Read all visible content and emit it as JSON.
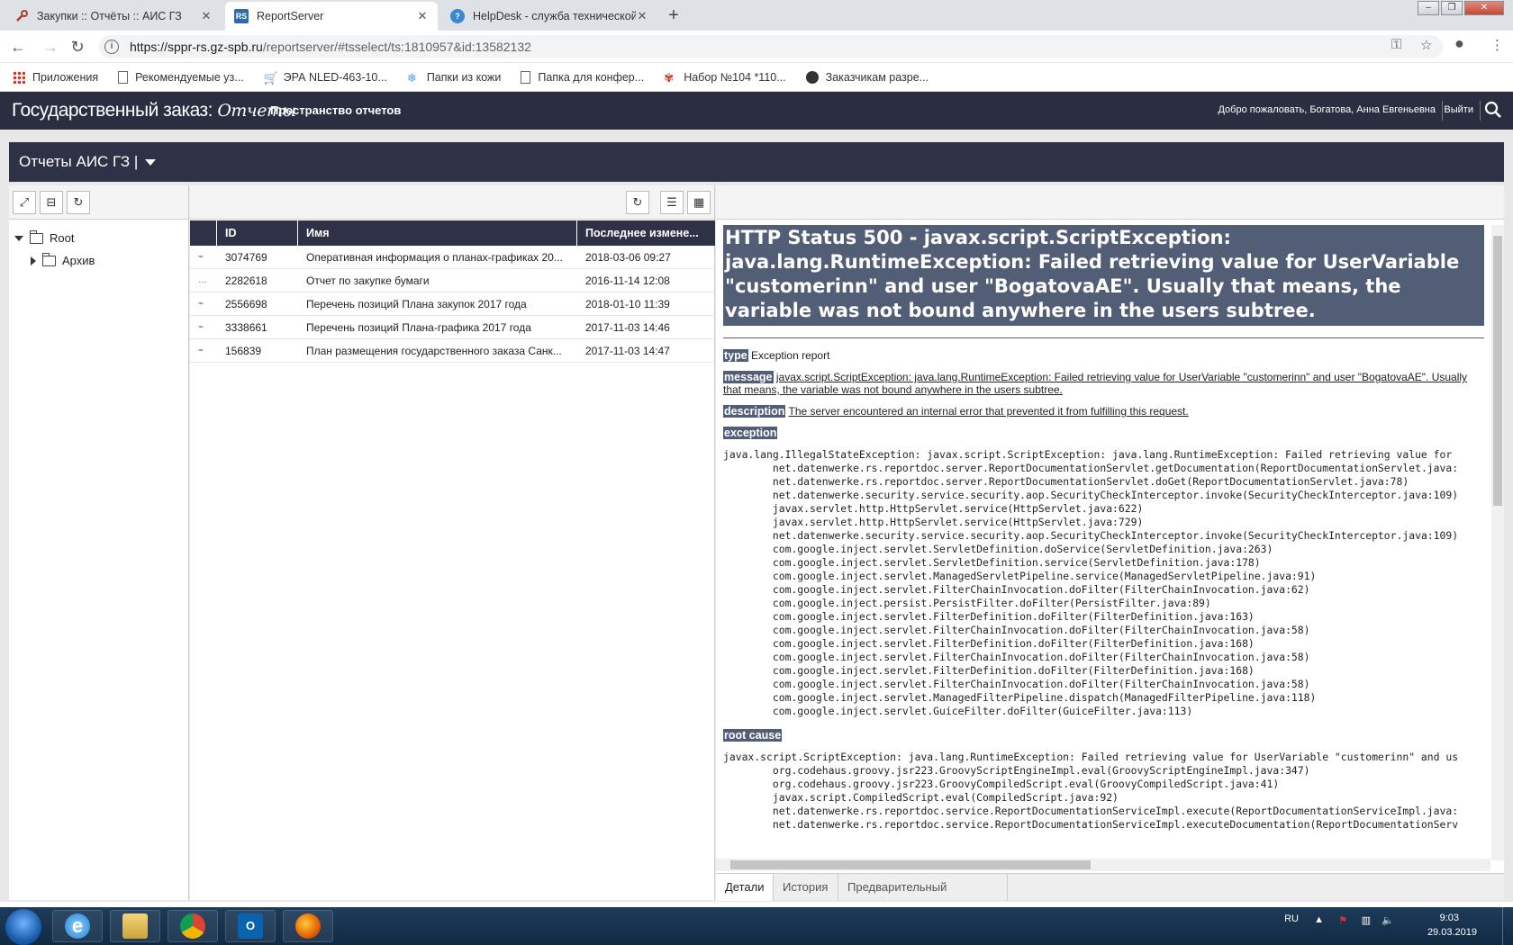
{
  "browser": {
    "tabs": [
      {
        "title": "Закупки :: Отчёты :: АИС ГЗ"
      },
      {
        "title": "ReportServer"
      },
      {
        "title": "HelpDesk - служба технической"
      }
    ],
    "url_host": "https://sppr-rs.gz-spb.ru",
    "url_path": "/reportserver/#tsselect/ts:1810957&id:13582132",
    "bookmarks": [
      "Приложения",
      "Рекомендуемые уз...",
      "ЭРА NLED-463-10...",
      "Папки из кожи",
      "Папка для конфер...",
      "Набор №104 *110...",
      "Заказчикам разре..."
    ]
  },
  "app": {
    "logo_main": "Государственный заказ:",
    "logo_script": "Отчеты",
    "title": "Пространство отчетов",
    "welcome": "Добро пожаловать, Богатова, Анна Евгеньевна",
    "logout": "Выйти"
  },
  "module": {
    "title": "Отчеты АИС ГЗ |"
  },
  "tree": {
    "root": "Root",
    "child": "Архив"
  },
  "grid": {
    "headers": [
      "ID",
      "Имя",
      "Последнее измене..."
    ],
    "rows": [
      {
        "id": "3074769",
        "name": "Оперативная информация о планах-графиках 20...",
        "date": "2018-03-06 09:27"
      },
      {
        "id": "2282618",
        "name": "Отчет по закупке бумаги",
        "date": "2016-11-14 12:08"
      },
      {
        "id": "2556698",
        "name": "Перечень позиций Плана закупок 2017 года",
        "date": "2018-01-10 11:39"
      },
      {
        "id": "3338661",
        "name": "Перечень позиций Плана-графика 2017 года",
        "date": "2017-11-03 14:46"
      },
      {
        "id": "156839",
        "name": "План размещения государственного заказа Санк...",
        "date": "2017-11-03 14:47"
      }
    ]
  },
  "error": {
    "title": "HTTP Status 500 - javax.script.ScriptException: java.lang.RuntimeException: Failed retrieving value for UserVariable \"customerinn\" and user \"BogatovaAE\". Usually that means, the variable was not bound anywhere in the users subtree.",
    "type_label": "type",
    "type_value": "Exception report",
    "message_label": "message",
    "message_value": "javax.script.ScriptException: java.lang.RuntimeException: Failed retrieving value for UserVariable \"customerinn\" and user \"BogatovaAE\". Usually that means, the variable was not bound anywhere in the users subtree.",
    "description_label": "description",
    "description_value": "The server encountered an internal error that prevented it from fulfilling this request.",
    "exception_label": "exception",
    "exception_trace": "java.lang.IllegalStateException: javax.script.ScriptException: java.lang.RuntimeException: Failed retrieving value for\n\tnet.datenwerke.rs.reportdoc.server.ReportDocumentationServlet.getDocumentation(ReportDocumentationServlet.java:\n\tnet.datenwerke.rs.reportdoc.server.ReportDocumentationServlet.doGet(ReportDocumentationServlet.java:78)\n\tnet.datenwerke.security.service.security.aop.SecurityCheckInterceptor.invoke(SecurityCheckInterceptor.java:109)\n\tjavax.servlet.http.HttpServlet.service(HttpServlet.java:622)\n\tjavax.servlet.http.HttpServlet.service(HttpServlet.java:729)\n\tnet.datenwerke.security.service.security.aop.SecurityCheckInterceptor.invoke(SecurityCheckInterceptor.java:109)\n\tcom.google.inject.servlet.ServletDefinition.doService(ServletDefinition.java:263)\n\tcom.google.inject.servlet.ServletDefinition.service(ServletDefinition.java:178)\n\tcom.google.inject.servlet.ManagedServletPipeline.service(ManagedServletPipeline.java:91)\n\tcom.google.inject.servlet.FilterChainInvocation.doFilter(FilterChainInvocation.java:62)\n\tcom.google.inject.persist.PersistFilter.doFilter(PersistFilter.java:89)\n\tcom.google.inject.servlet.FilterDefinition.doFilter(FilterDefinition.java:163)\n\tcom.google.inject.servlet.FilterChainInvocation.doFilter(FilterChainInvocation.java:58)\n\tcom.google.inject.servlet.FilterDefinition.doFilter(FilterDefinition.java:168)\n\tcom.google.inject.servlet.FilterChainInvocation.doFilter(FilterChainInvocation.java:58)\n\tcom.google.inject.servlet.FilterDefinition.doFilter(FilterDefinition.java:168)\n\tcom.google.inject.servlet.FilterChainInvocation.doFilter(FilterChainInvocation.java:58)\n\tcom.google.inject.servlet.ManagedFilterPipeline.dispatch(ManagedFilterPipeline.java:118)\n\tcom.google.inject.servlet.GuiceFilter.doFilter(GuiceFilter.java:113)",
    "root_cause_label": "root cause",
    "root_cause_trace": "javax.script.ScriptException: java.lang.RuntimeException: Failed retrieving value for UserVariable \"customerinn\" and us\n\torg.codehaus.groovy.jsr223.GroovyScriptEngineImpl.eval(GroovyScriptEngineImpl.java:347)\n\torg.codehaus.groovy.jsr223.GroovyCompiledScript.eval(GroovyCompiledScript.java:41)\n\tjavax.script.CompiledScript.eval(CompiledScript.java:92)\n\tnet.datenwerke.rs.reportdoc.service.ReportDocumentationServiceImpl.execute(ReportDocumentationServiceImpl.java:\n\tnet.datenwerke.rs.reportdoc.service.ReportDocumentationServiceImpl.executeDocumentation(ReportDocumentationServ"
  },
  "bottom_tabs": [
    "Детали",
    "История",
    "Предварительный просмотр"
  ],
  "tray": {
    "lang": "RU",
    "time": "9:03",
    "date": "29.03.2019"
  },
  "colors": {
    "header_bg": "#2b2d41",
    "error_title_bg": "#525d76"
  }
}
